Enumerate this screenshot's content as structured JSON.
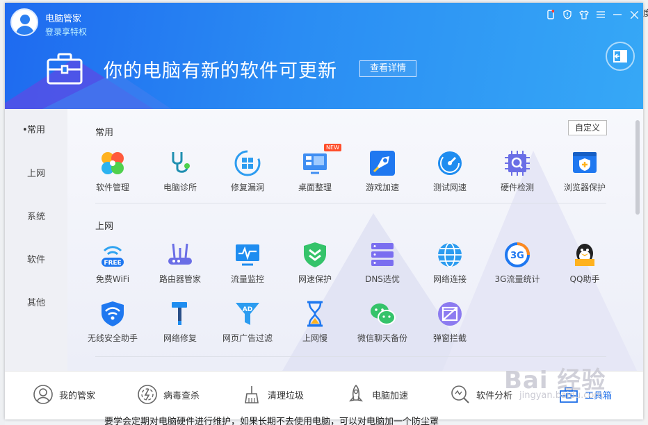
{
  "app": {
    "name": "电脑管家",
    "login_link": "登录享特权"
  },
  "banner": {
    "message": "你的电脑有新的软件可更新",
    "button": "查看详情"
  },
  "sidebar": {
    "items": [
      {
        "label": "常用",
        "active": true
      },
      {
        "label": "上网",
        "active": false
      },
      {
        "label": "系统",
        "active": false
      },
      {
        "label": "软件",
        "active": false
      },
      {
        "label": "其他",
        "active": false
      }
    ]
  },
  "sections": {
    "common": {
      "title": "常用",
      "customize": "自定义",
      "tools": [
        {
          "label": "软件管理",
          "icon": "clover-icon"
        },
        {
          "label": "电脑诊所",
          "icon": "stethoscope-icon"
        },
        {
          "label": "修复漏洞",
          "icon": "repair-icon"
        },
        {
          "label": "桌面整理",
          "icon": "desktop-icon",
          "badge": "NEW"
        },
        {
          "label": "游戏加速",
          "icon": "game-boost-icon"
        },
        {
          "label": "测试网速",
          "icon": "speedometer-icon"
        },
        {
          "label": "硬件检测",
          "icon": "chip-icon"
        },
        {
          "label": "浏览器保护",
          "icon": "browser-shield-icon"
        }
      ]
    },
    "internet": {
      "title": "上网",
      "tools": [
        {
          "label": "免费WiFi",
          "icon": "free-wifi-icon",
          "icon_text": "FREE"
        },
        {
          "label": "路由器管家",
          "icon": "router-icon"
        },
        {
          "label": "流量监控",
          "icon": "traffic-monitor-icon"
        },
        {
          "label": "网速保护",
          "icon": "speed-shield-icon"
        },
        {
          "label": "DNS选优",
          "icon": "dns-icon"
        },
        {
          "label": "网络连接",
          "icon": "globe-icon"
        },
        {
          "label": "3G流量统计",
          "icon": "3g-icon",
          "icon_text": "3G"
        },
        {
          "label": "QQ助手",
          "icon": "qq-icon"
        },
        {
          "label": "无线安全助手",
          "icon": "wifi-shield-icon"
        },
        {
          "label": "网络修复",
          "icon": "hammer-icon"
        },
        {
          "label": "网页广告过滤",
          "icon": "ad-filter-icon",
          "icon_text": "AD"
        },
        {
          "label": "上网慢",
          "icon": "hourglass-icon"
        },
        {
          "label": "微信聊天备份",
          "icon": "wechat-icon"
        },
        {
          "label": "弹窗拦截",
          "icon": "popup-block-icon"
        }
      ]
    }
  },
  "bottom_nav": [
    {
      "label": "我的管家",
      "icon": "butler-icon",
      "active": false
    },
    {
      "label": "病毒查杀",
      "icon": "virus-scan-icon",
      "active": false
    },
    {
      "label": "清理垃圾",
      "icon": "cleanup-icon",
      "active": false
    },
    {
      "label": "电脑加速",
      "icon": "rocket-icon",
      "active": false
    },
    {
      "label": "软件分析",
      "icon": "analysis-icon",
      "active": false
    },
    {
      "label": "工具箱",
      "icon": "toolbox-icon",
      "active": true
    }
  ],
  "watermark": {
    "text": "Bai 经验",
    "sub": "jingyan.baidu.com"
  },
  "page_fragments": {
    "right_char": "度",
    "bottom_text": "要学会定期对电脑硬件进行维护，如果长期不去使用电脑，可以对电脑加一个防尘罩"
  },
  "colors": {
    "header_blue": "#2a8cf3",
    "accent": "#1f6fe8"
  }
}
